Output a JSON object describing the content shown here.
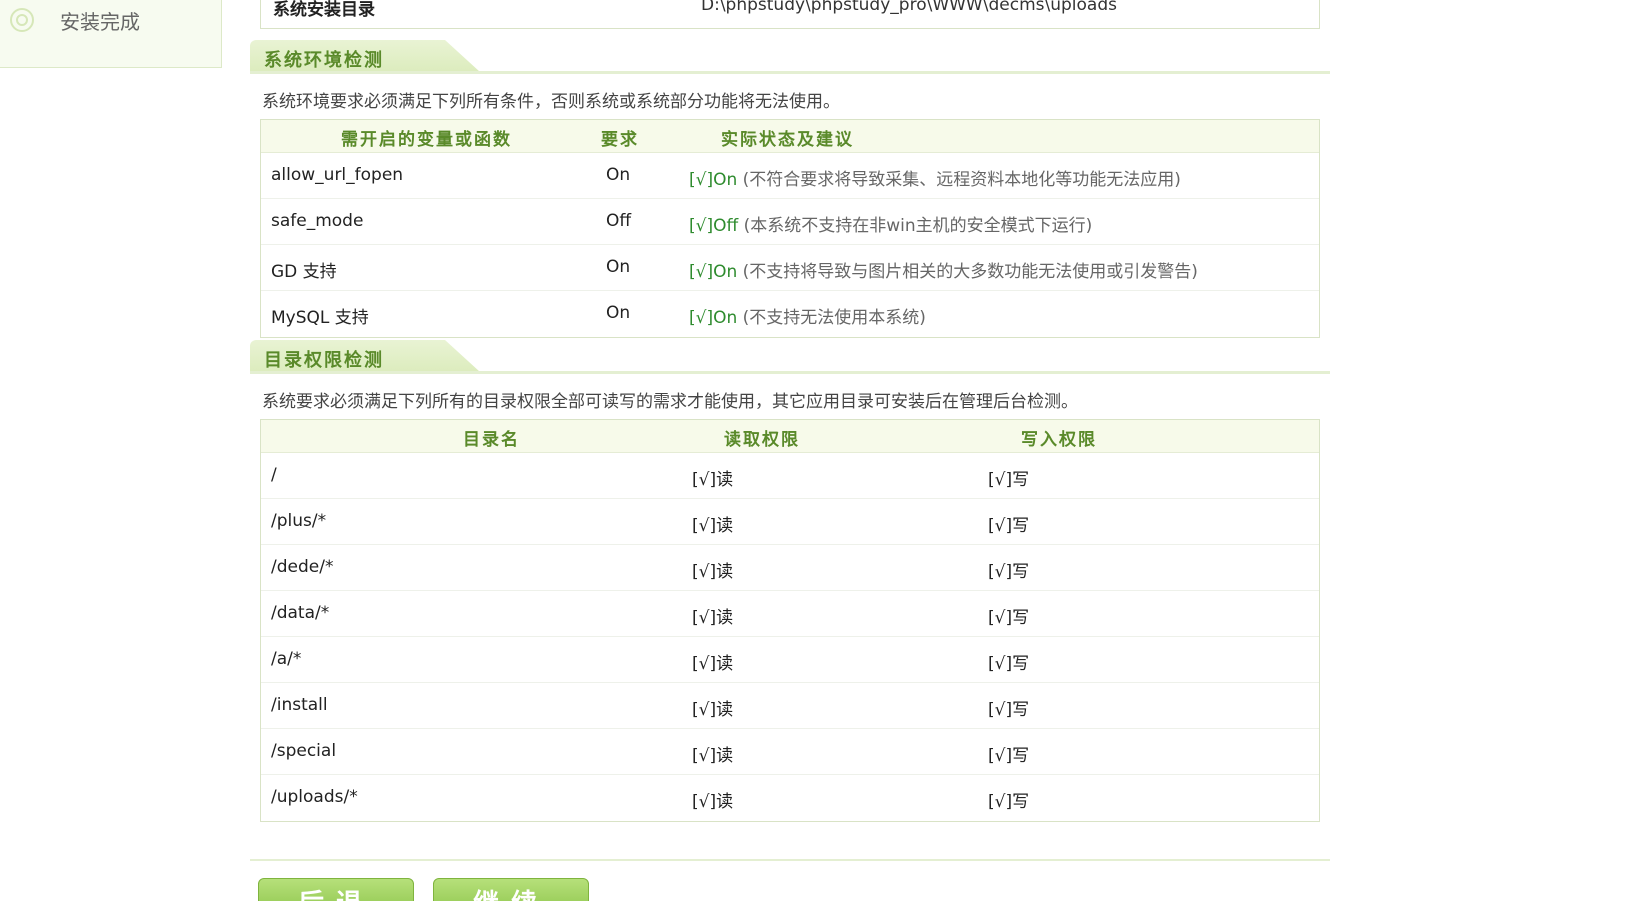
{
  "sidebar": {
    "steps": [
      {
        "label": "安装完成",
        "icon": "step-circle-icon"
      }
    ]
  },
  "top_row": {
    "key": "系统安装目录",
    "value": "D:\\phpstudy\\phpstudy_pro\\WWW\\decms\\uploads"
  },
  "env_check": {
    "title": "系统环境检测",
    "description": "系统环境要求必须满足下列所有条件，否则系统或系统部分功能将无法使用。",
    "headers": [
      "需开启的变量或函数",
      "要求",
      "实际状态及建议"
    ],
    "rows": [
      {
        "name": "allow_url_fopen",
        "required": "On",
        "status": "[√]On",
        "note": "(不符合要求将导致采集、远程资料本地化等功能无法应用)"
      },
      {
        "name": "safe_mode",
        "required": "Off",
        "status": "[√]Off",
        "note": "(本系统不支持在非win主机的安全模式下运行)"
      },
      {
        "name": "GD 支持",
        "required": "On",
        "status": "[√]On",
        "note": "(不支持将导致与图片相关的大多数功能无法使用或引发警告)"
      },
      {
        "name": "MySQL 支持",
        "required": "On",
        "status": "[√]On",
        "note": "(不支持无法使用本系统)"
      }
    ]
  },
  "dir_check": {
    "title": "目录权限检测",
    "description": "系统要求必须满足下列所有的目录权限全部可读写的需求才能使用，其它应用目录可安装后在管理后台检测。",
    "headers": [
      "目录名",
      "读取权限",
      "写入权限"
    ],
    "rows": [
      {
        "dir": "/",
        "read": "[√]读",
        "write": "[√]写"
      },
      {
        "dir": "/plus/*",
        "read": "[√]读",
        "write": "[√]写"
      },
      {
        "dir": "/dede/*",
        "read": "[√]读",
        "write": "[√]写"
      },
      {
        "dir": "/data/*",
        "read": "[√]读",
        "write": "[√]写"
      },
      {
        "dir": "/a/*",
        "read": "[√]读",
        "write": "[√]写"
      },
      {
        "dir": "/install",
        "read": "[√]读",
        "write": "[√]写"
      },
      {
        "dir": "/special",
        "read": "[√]读",
        "write": "[√]写"
      },
      {
        "dir": "/uploads/*",
        "read": "[√]读",
        "write": "[√]写"
      }
    ]
  },
  "buttons": {
    "back": "后退",
    "continue": "继续"
  },
  "colors": {
    "accent": "#5a8a2a",
    "ok": "#2e8b2e",
    "button": "#9ccf5a"
  }
}
